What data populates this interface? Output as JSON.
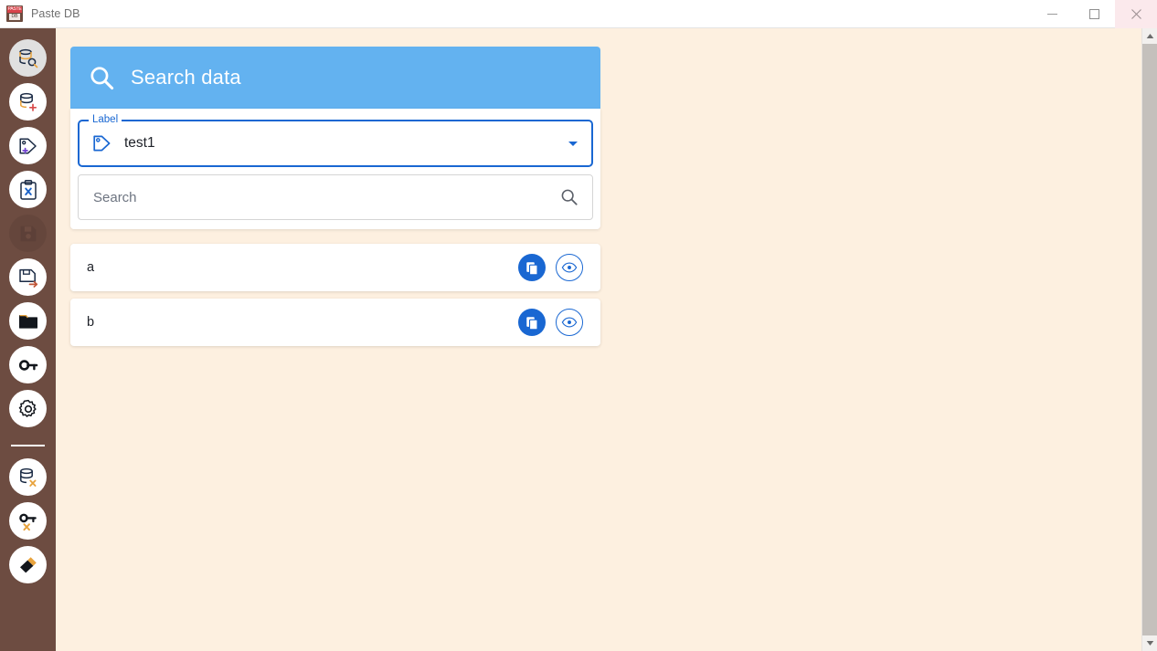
{
  "window": {
    "title": "Paste DB",
    "app_icon": "paste-db-icon",
    "icon_text_top": "PASTE",
    "icon_text_bottom": "DB",
    "controls": [
      {
        "name": "minimize",
        "glyph": "minimize-icon"
      },
      {
        "name": "maximize",
        "glyph": "maximize-icon"
      },
      {
        "name": "close",
        "glyph": "close-icon"
      }
    ]
  },
  "colors": {
    "sidebar": "#6d4c41",
    "banner_blue": "#63b2f0",
    "accent_blue": "#1967d2",
    "page_background": "#fdf0e0",
    "card": "#ffffff",
    "close_hover": "#fbe9ec"
  },
  "sidebar": {
    "items": [
      {
        "name": "search-data",
        "icon": "database-search-icon",
        "active": true,
        "disabled": false
      },
      {
        "name": "add-data",
        "icon": "database-plus-icon",
        "active": false,
        "disabled": false
      },
      {
        "name": "add-label",
        "icon": "tag-plus-icon",
        "active": false,
        "disabled": false
      },
      {
        "name": "clipboard-clear",
        "icon": "clipboard-x-icon",
        "active": false,
        "disabled": false
      },
      {
        "name": "save",
        "icon": "floppy-save-icon",
        "active": false,
        "disabled": true
      },
      {
        "name": "export-database",
        "icon": "save-export-icon",
        "active": false,
        "disabled": false
      },
      {
        "name": "open-database",
        "icon": "folder-icon",
        "active": false,
        "disabled": false
      },
      {
        "name": "password",
        "icon": "key-icon",
        "active": false,
        "disabled": false
      },
      {
        "name": "settings",
        "icon": "gear-icon",
        "active": false,
        "disabled": false
      }
    ],
    "items_bottom": [
      {
        "name": "delete-database",
        "icon": "database-x-icon",
        "active": false,
        "disabled": false
      },
      {
        "name": "delete-key",
        "icon": "key-x-icon",
        "active": false,
        "disabled": false
      },
      {
        "name": "clean-up",
        "icon": "broom-icon",
        "active": false,
        "disabled": false
      }
    ]
  },
  "panel": {
    "header": {
      "title": "Search data",
      "icon": "search-icon"
    },
    "label_field": {
      "legend": "Label",
      "icon": "tag-icon",
      "value": "test1",
      "caret": "chevron-down-icon"
    },
    "search_field": {
      "placeholder": "Search",
      "value": "",
      "icon": "search-icon"
    }
  },
  "results": {
    "rows": [
      {
        "text": "a",
        "copy_icon": "copy-icon",
        "reveal_icon": "eye-icon"
      },
      {
        "text": "b",
        "copy_icon": "copy-icon",
        "reveal_icon": "eye-icon"
      }
    ]
  },
  "scrollbar": {
    "up_arrow": "chevron-up-icon",
    "down_arrow": "chevron-down-icon",
    "thumb": "scroll-thumb"
  }
}
